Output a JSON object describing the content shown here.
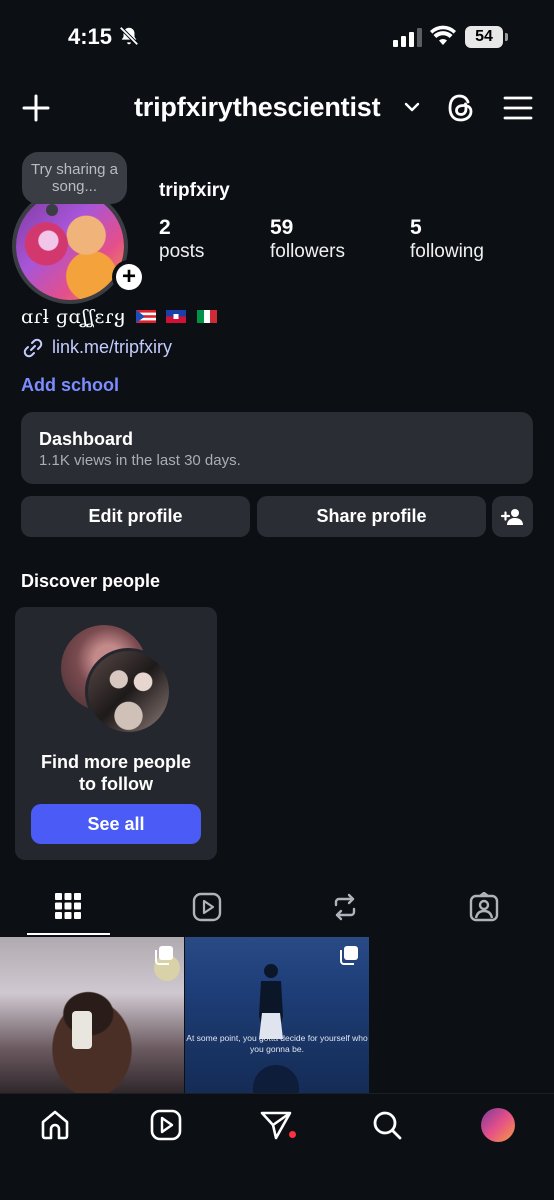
{
  "status_bar": {
    "time": "4:15",
    "battery": "54"
  },
  "header": {
    "username": "tripfxirythescientist"
  },
  "profile": {
    "note": "Try sharing a song...",
    "name": "tripfxiry",
    "stats": [
      {
        "value": "2",
        "label": "posts"
      },
      {
        "value": "59",
        "label": "followers"
      },
      {
        "value": "5",
        "label": "following"
      }
    ],
    "bio": "ɑɾƚ ɡɑʆʆɛɾყ",
    "link": "link.me/tripfxiry",
    "add_school": "Add school"
  },
  "dashboard": {
    "title": "Dashboard",
    "subtitle": "1.1K views in the last 30 days."
  },
  "actions": {
    "edit_profile": "Edit profile",
    "share_profile": "Share profile"
  },
  "discover": {
    "title": "Discover people",
    "card_text_line1": "Find more people",
    "card_text_line2": "to follow",
    "button": "See all"
  },
  "posts": {
    "items": [
      {
        "caption": ""
      },
      {
        "caption": "At some point, you gotta decide for yourself who you gonna be."
      }
    ]
  },
  "icons": {
    "header": [
      "plus-icon",
      "chevron-down-icon",
      "threads-icon",
      "menu-icon"
    ],
    "tabs": [
      "grid-icon",
      "reels-icon",
      "reposts-icon",
      "tagged-icon"
    ],
    "nav": [
      "home-icon",
      "reels-icon",
      "direct-icon",
      "search-icon",
      "profile-avatar"
    ]
  },
  "colors": {
    "accent": "#4a5cf5",
    "link": "#c3cbff",
    "add_school": "#7d8cff",
    "notification_dot": "#ff3040"
  }
}
